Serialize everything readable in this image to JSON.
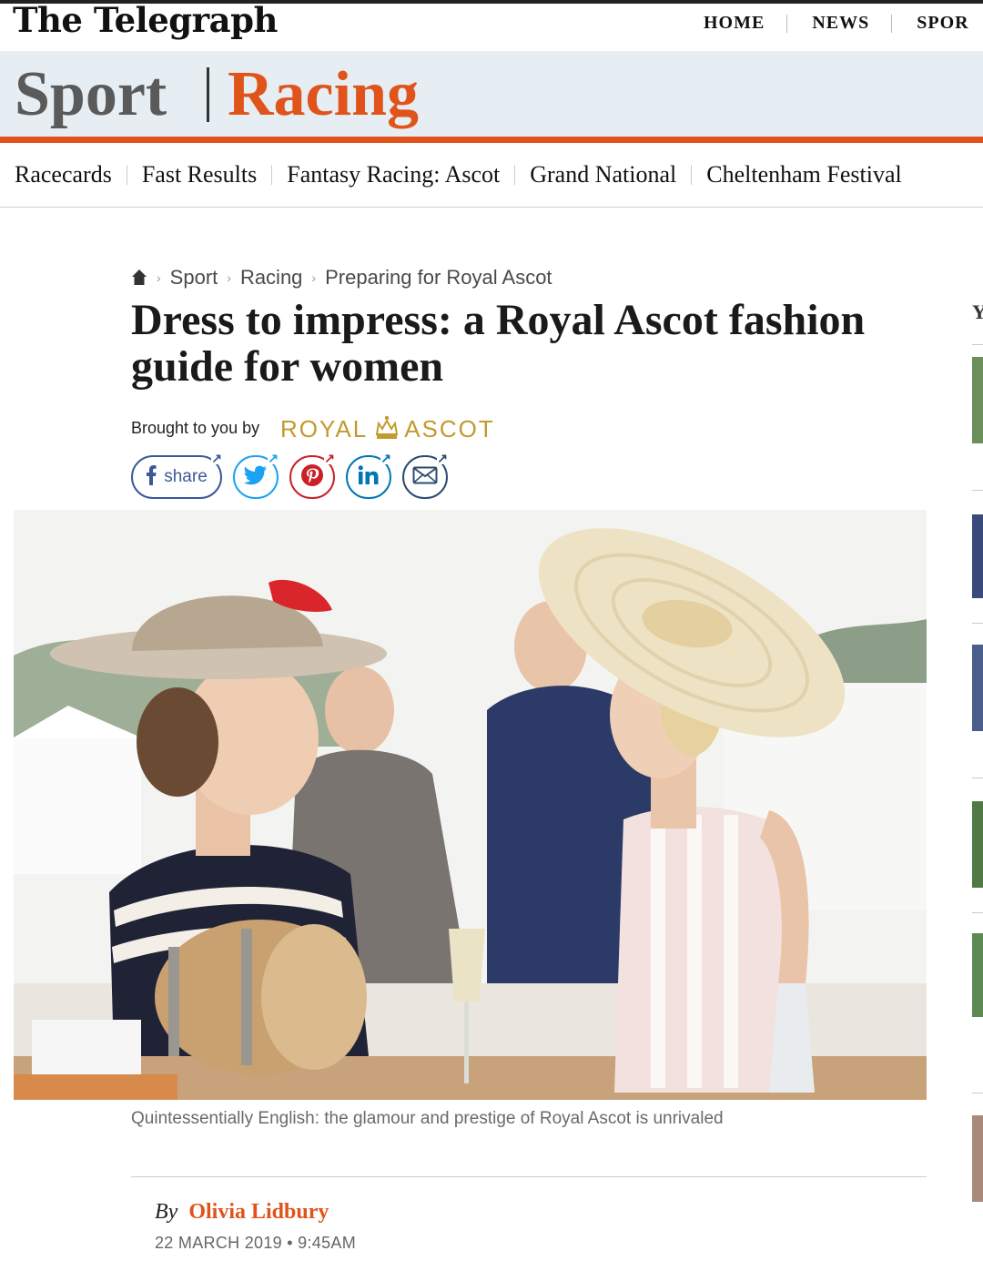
{
  "masthead": {
    "logo": "The Telegraph",
    "nav": [
      "HOME",
      "NEWS",
      "SPOR"
    ]
  },
  "section": {
    "primary": "Sport",
    "secondary": "Racing",
    "accent": "#e0541c"
  },
  "subnav": [
    "Racecards",
    "Fast Results",
    "Fantasy Racing: Ascot",
    "Grand National",
    "Cheltenham Festival"
  ],
  "breadcrumb": {
    "items": [
      "Sport",
      "Racing",
      "Preparing for Royal Ascot"
    ]
  },
  "article": {
    "headline": "Dress to impress: a Royal Ascot fashion guide for women",
    "brought_by": "Brought to you by",
    "sponsor_left": "ROYAL",
    "sponsor_right": "ASCOT",
    "share_label": "share",
    "caption": "Quintessentially English: the glamour and prestige of Royal Ascot is unrivaled",
    "byline_prefix": "By",
    "author": "Olivia Lidbury",
    "date": "22 MARCH 2019 • 9:45AM"
  },
  "share_icons": [
    "facebook-icon",
    "twitter-icon",
    "pinterest-icon",
    "linkedin-icon",
    "email-icon"
  ],
  "rail": {
    "heading_fragment": "Y"
  }
}
